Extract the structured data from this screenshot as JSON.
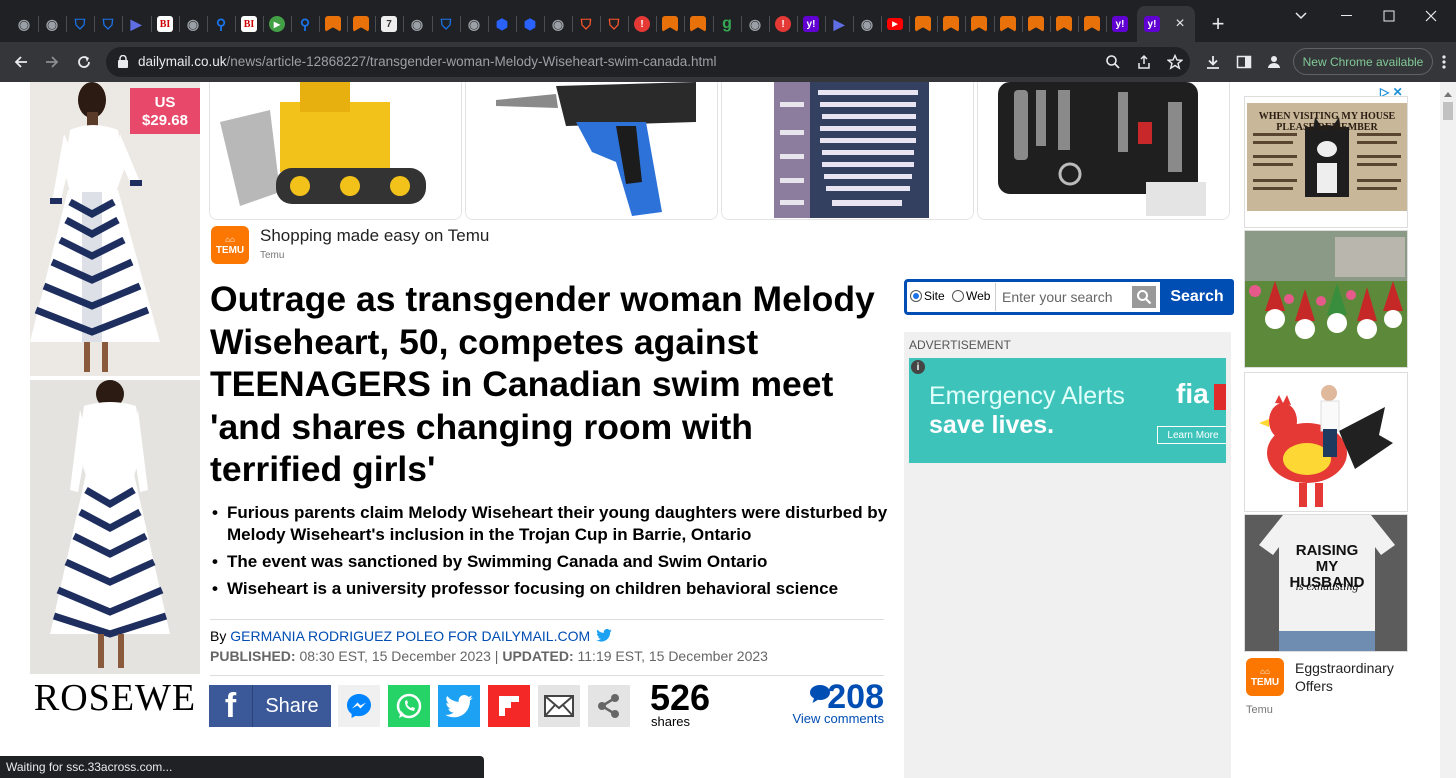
{
  "browser": {
    "active_tab_close": "×",
    "new_tab": "+",
    "tab_favicons": [
      {
        "icon": "globe-icon",
        "color": "#9aa0a6",
        "glyph": "◉"
      },
      {
        "icon": "globe-icon",
        "color": "#9aa0a6",
        "glyph": "◉"
      },
      {
        "icon": "shield-icon",
        "color": "#1a73e8",
        "glyph": "⛉"
      },
      {
        "icon": "shield-icon",
        "color": "#1a73e8",
        "glyph": "⛉"
      },
      {
        "icon": "arrow-icon",
        "color": "#5f6ee3",
        "glyph": "▶"
      },
      {
        "icon": "business-insider-icon",
        "color": "#c00",
        "glyph": "BI"
      },
      {
        "icon": "globe-icon",
        "color": "#9aa0a6",
        "glyph": "◉"
      },
      {
        "icon": "search-icon",
        "color": "#1a73e8",
        "glyph": "⚲"
      },
      {
        "icon": "business-insider-icon",
        "color": "#c00",
        "glyph": "BI"
      },
      {
        "icon": "play-icon",
        "color": "#43a047",
        "glyph": "▶"
      },
      {
        "icon": "search-icon",
        "color": "#1a73e8",
        "glyph": "⚲"
      },
      {
        "icon": "bookmark-icon",
        "color": "#e8710a",
        "glyph": "▮"
      },
      {
        "icon": "bookmark-icon",
        "color": "#e8710a",
        "glyph": "▮"
      },
      {
        "icon": "document-icon",
        "color": "#ddd",
        "glyph": "7"
      },
      {
        "icon": "globe-icon",
        "color": "#9aa0a6",
        "glyph": "◉"
      },
      {
        "icon": "shield-icon",
        "color": "#1a73e8",
        "glyph": "⛉"
      },
      {
        "icon": "globe-icon",
        "color": "#9aa0a6",
        "glyph": "◉"
      },
      {
        "icon": "cube-icon",
        "color": "#2962ff",
        "glyph": "⬢"
      },
      {
        "icon": "cube-icon",
        "color": "#2962ff",
        "glyph": "⬢"
      },
      {
        "icon": "globe-icon",
        "color": "#9aa0a6",
        "glyph": "◉"
      },
      {
        "icon": "brave-shield-icon",
        "color": "#fb542b",
        "glyph": "⛉"
      },
      {
        "icon": "brave-shield-icon",
        "color": "#fb542b",
        "glyph": "⛉"
      },
      {
        "icon": "alert-icon",
        "color": "#e53935",
        "glyph": "!"
      },
      {
        "icon": "bookmark-icon",
        "color": "#e8710a",
        "glyph": "▮"
      },
      {
        "icon": "bookmark-icon",
        "color": "#e8710a",
        "glyph": "▮"
      },
      {
        "icon": "g-icon",
        "color": "#34a853",
        "glyph": "g"
      },
      {
        "icon": "globe-icon",
        "color": "#9aa0a6",
        "glyph": "◉"
      },
      {
        "icon": "alert-icon",
        "color": "#e53935",
        "glyph": "!"
      },
      {
        "icon": "yahoo-icon",
        "color": "#6001d2",
        "glyph": "y!"
      },
      {
        "icon": "arrow-icon",
        "color": "#5f6ee3",
        "glyph": "▶"
      },
      {
        "icon": "globe-icon",
        "color": "#9aa0a6",
        "glyph": "◉"
      },
      {
        "icon": "youtube-icon",
        "color": "#ff0000",
        "glyph": "▶"
      },
      {
        "icon": "bookmark-icon",
        "color": "#e8710a",
        "glyph": "▮"
      },
      {
        "icon": "bookmark-icon",
        "color": "#e8710a",
        "glyph": "▮"
      },
      {
        "icon": "bookmark-icon",
        "color": "#e8710a",
        "glyph": "▮"
      },
      {
        "icon": "bookmark-icon",
        "color": "#e8710a",
        "glyph": "▮"
      },
      {
        "icon": "bookmark-icon",
        "color": "#e8710a",
        "glyph": "▮"
      },
      {
        "icon": "bookmark-icon",
        "color": "#e8710a",
        "glyph": "▮"
      },
      {
        "icon": "bookmark-icon",
        "color": "#e8710a",
        "glyph": "▮"
      },
      {
        "icon": "yahoo-icon",
        "color": "#6001d2",
        "glyph": "y!"
      }
    ],
    "url_host": "dailymail.co.uk",
    "url_path": "/news/article-12868227/transgender-woman-Melody-Wiseheart-swim-canada.html",
    "new_chrome_label": "New Chrome available",
    "status_text": "Waiting for ssc.33across.com..."
  },
  "left_ad": {
    "price_currency": "US",
    "price": "$29.68",
    "brand": "ROSEWE"
  },
  "sponsored": {
    "title": "Shopping made easy on Temu",
    "brand": "Temu",
    "logo_text": "TEMU"
  },
  "article": {
    "headline": "Outrage as transgender woman Melody Wiseheart, 50, competes against TEENAGERS in Canadian swim meet 'and shares changing room with terrified girls'",
    "bullets": [
      "Furious parents claim Melody Wiseheart their young daughters were disturbed by Melody Wiseheart's inclusion in the Trojan Cup in Barrie, Ontario",
      "The event was sanctioned by Swimming Canada and Swim Ontario",
      "Wiseheart is a university professor focusing on children behavioral science"
    ],
    "byline_prefix": "By ",
    "author": "GERMANIA RODRIGUEZ POLEO FOR DAILYMAIL.COM",
    "published_label": "PUBLISHED:",
    "published_value": " 08:30 EST, 15 December 2023 | ",
    "updated_label": "UPDATED:",
    "updated_value": " 11:19 EST, 15 December 2023",
    "share_label": "Share",
    "share_count": "526",
    "share_count_label": "shares",
    "comment_count": "208",
    "comment_link": "View comments"
  },
  "search": {
    "site_label": "Site",
    "web_label": "Web",
    "placeholder": "Enter your search",
    "button": "Search"
  },
  "ad_column": {
    "label": "ADVERTISEMENT",
    "fia_line1": "Emergency Alerts",
    "fia_line2": "save lives.",
    "fia_logo": "fia",
    "fia_cta": "Learn More",
    "info": "i"
  },
  "right_ad": {
    "cat_sign_title": "WHEN VISITING MY HOUSE PLEASE REMEMBER",
    "shirt_text": "RAISING MY HUSBAND",
    "shirt_script": "is exhausting",
    "offer_title": "Eggstraordinary Offers",
    "offer_brand": "Temu",
    "logo_text": "TEMU"
  }
}
